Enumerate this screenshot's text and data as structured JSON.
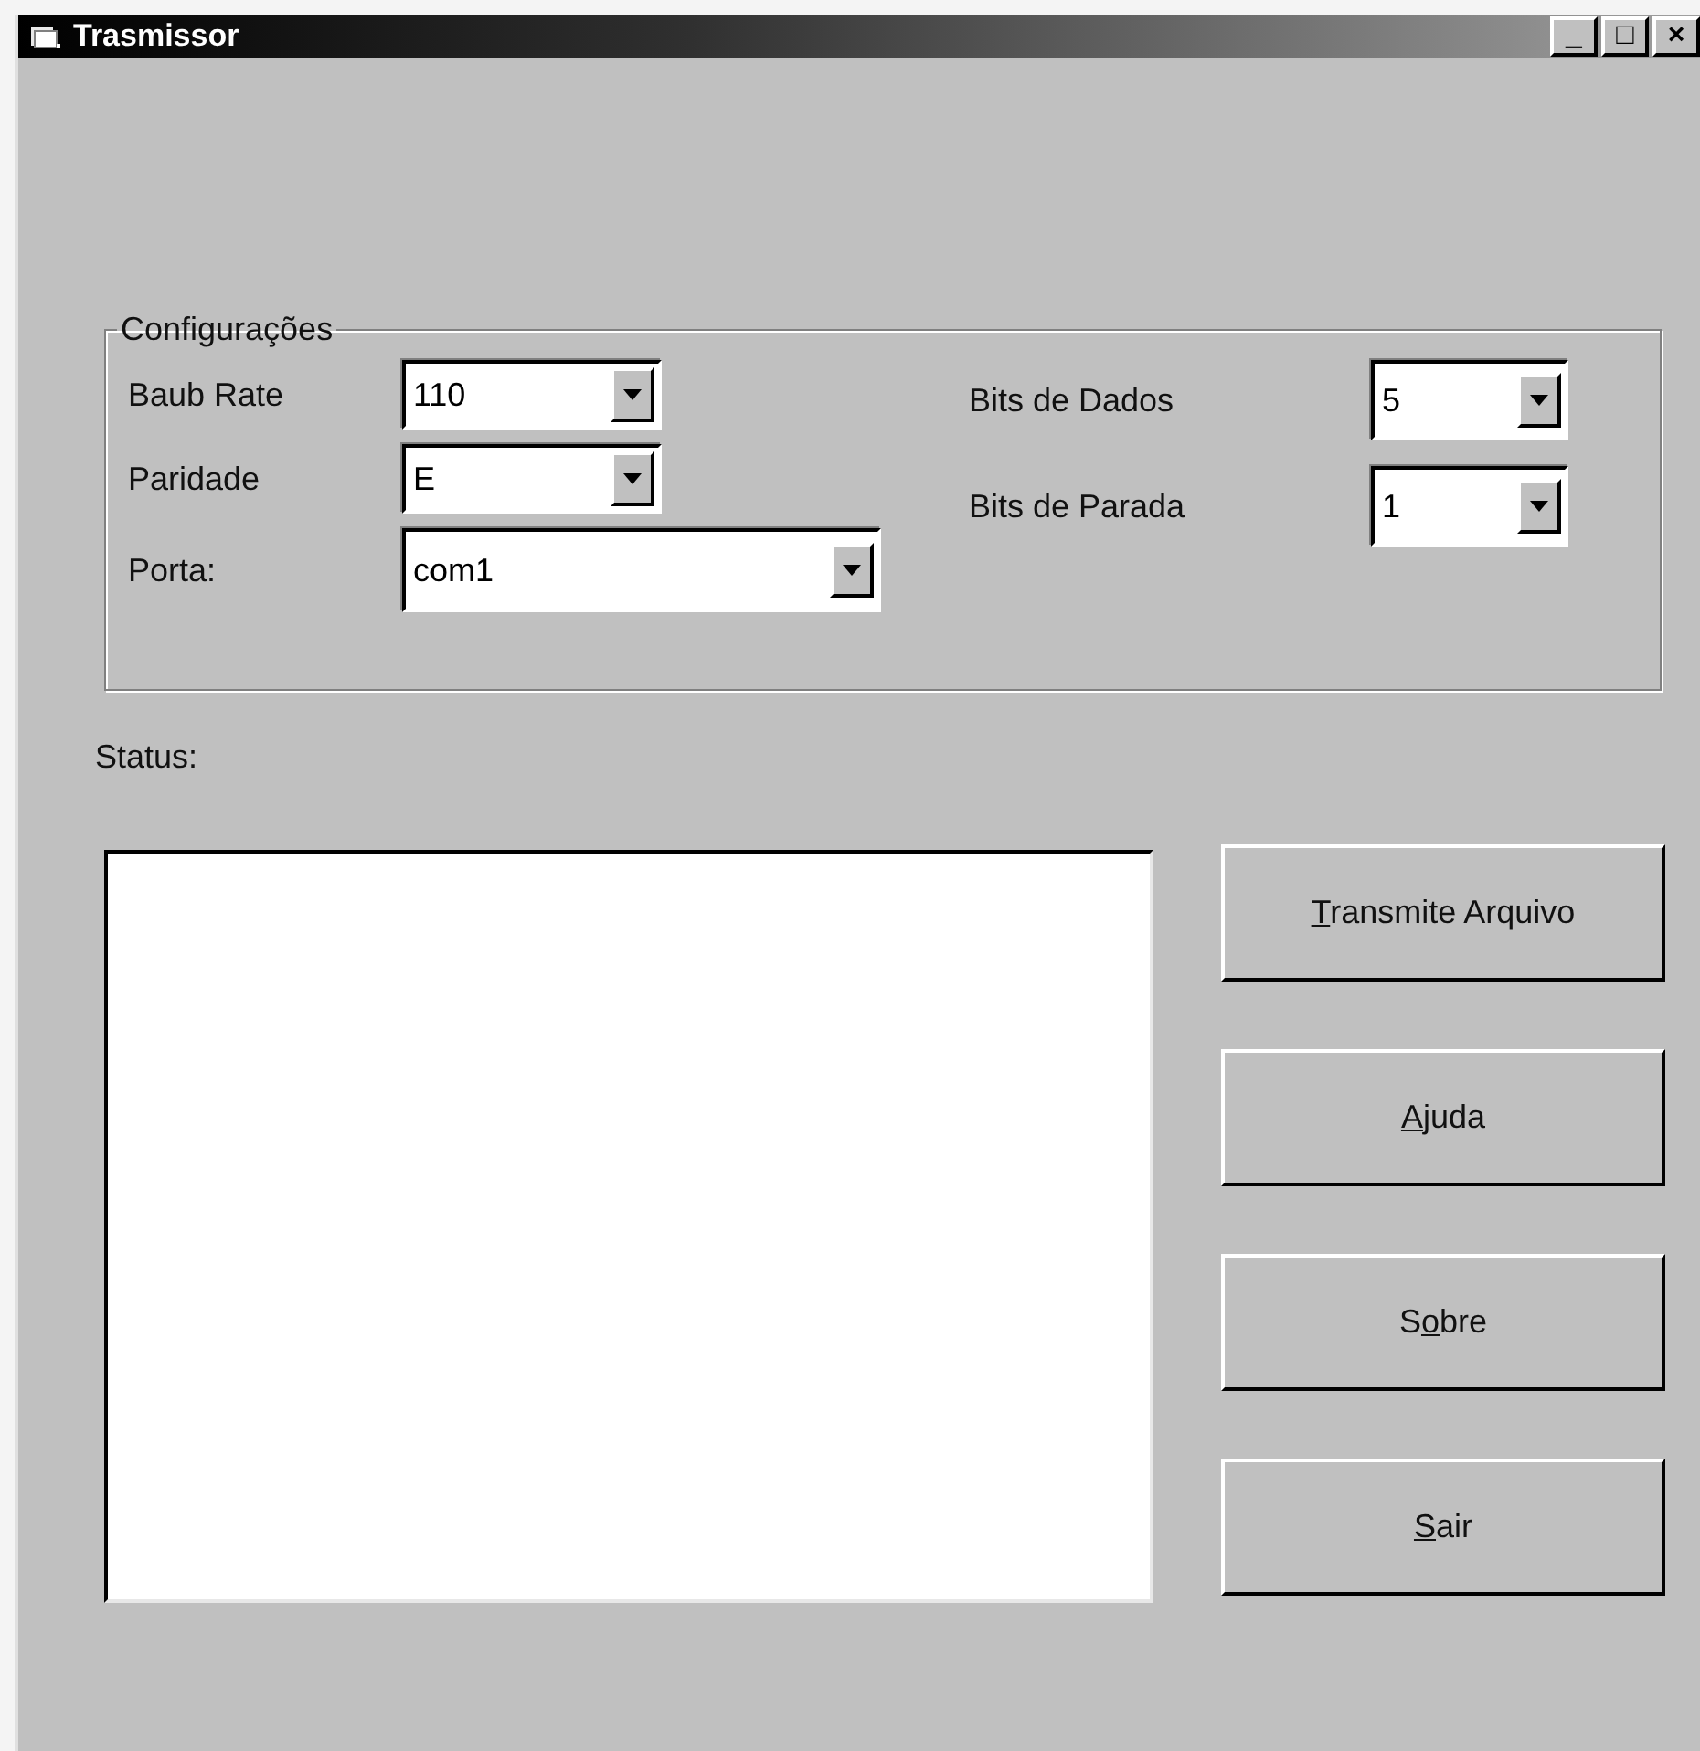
{
  "window": {
    "title": "Trasmissor",
    "controls": [
      "_",
      "□",
      "×"
    ]
  },
  "config": {
    "title": "Configurações",
    "left": [
      {
        "label": "Baub Rate",
        "value": "110",
        "wide": false
      },
      {
        "label": "Paridade",
        "value": "E",
        "wide": false
      },
      {
        "label": "Porta:",
        "value": "com1",
        "wide": true
      }
    ],
    "right": [
      {
        "label": "Bits de Dados",
        "value": "5"
      },
      {
        "label": "Bits de Parada",
        "value": "1"
      }
    ]
  },
  "status": {
    "label": "Status:"
  },
  "buttons": [
    {
      "key": "T",
      "after": "ransmite Arquivo"
    },
    {
      "key": "A",
      "after": "juda"
    },
    {
      "before": "S",
      "key": "o",
      "after": "bre"
    },
    {
      "key": "S",
      "after": "air"
    }
  ]
}
